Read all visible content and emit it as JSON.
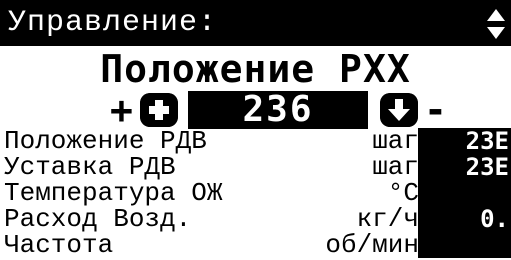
{
  "header": {
    "title": "Управление:",
    "scroll_icon": "up-down-arrows-icon"
  },
  "screen": {
    "title": "Положение РХХ"
  },
  "control": {
    "plus_label": "+",
    "minus_label": "-",
    "increment_icon": "plus-circle-icon",
    "decrement_icon": "arrow-down-circle-icon",
    "value": "236"
  },
  "params": [
    {
      "name": "Положение РДВ",
      "unit": "шаг",
      "value": "23Е"
    },
    {
      "name": "Уставка РДВ",
      "unit": "шаг",
      "value": "23Е"
    },
    {
      "name": "Температура ОЖ",
      "unit": "°С",
      "value": ""
    },
    {
      "name": "Расход Возд.",
      "unit": "кг/ч",
      "value": "0."
    },
    {
      "name": "Частота",
      "unit": "об/мин",
      "value": ""
    }
  ]
}
